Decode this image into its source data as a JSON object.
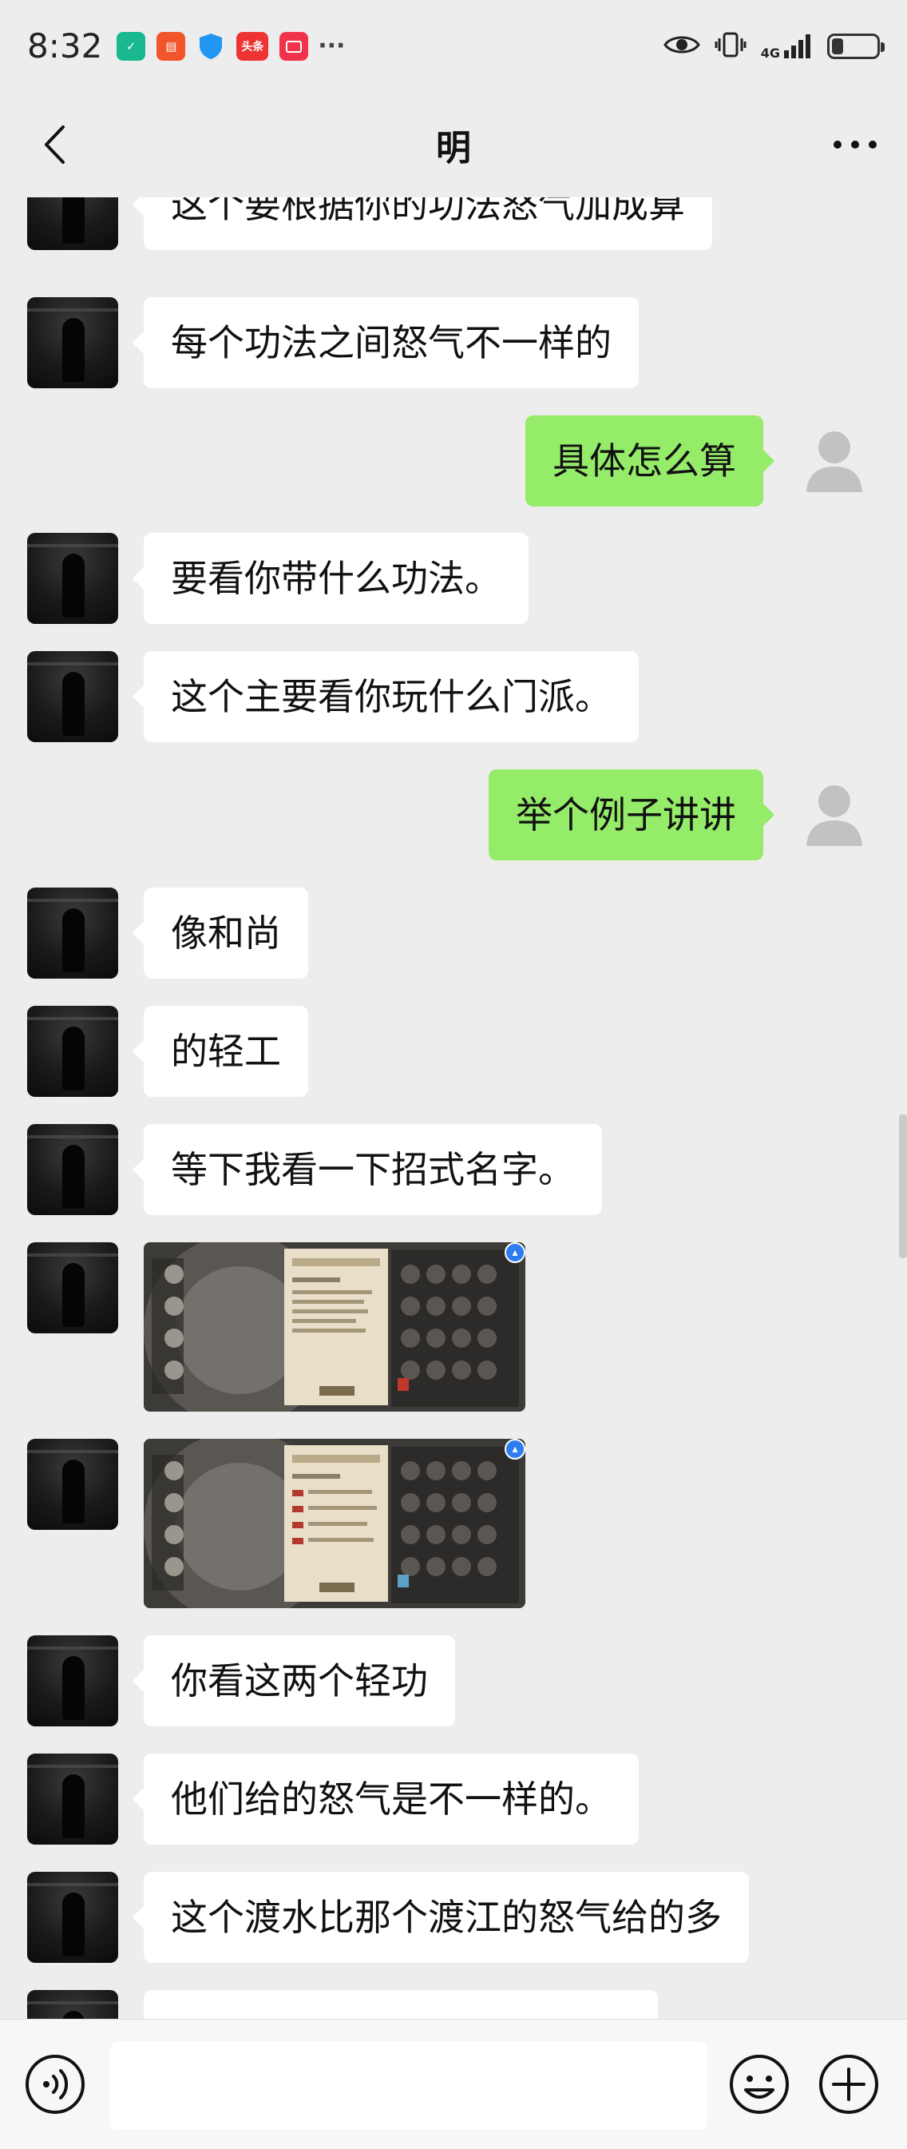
{
  "status_bar": {
    "time": "8:32",
    "notifications": [
      {
        "icon": "shield-app-icon",
        "label": ""
      },
      {
        "icon": "colorful-app-icon",
        "label": ""
      },
      {
        "icon": "blue-shield-icon",
        "label": ""
      },
      {
        "icon": "toutiao-icon",
        "label": "头条"
      },
      {
        "icon": "red-app-icon",
        "label": ""
      },
      {
        "icon": "more-notifications-icon",
        "label": "···"
      }
    ],
    "network": "4G",
    "battery_level": 0.25
  },
  "header": {
    "title": "明",
    "back_icon": "chevron-left-icon",
    "more_icon": "more-dots-icon"
  },
  "messages": [
    {
      "side": "left",
      "type": "text",
      "text": "这个要根据你的功法怒气加成算"
    },
    {
      "side": "left",
      "type": "text",
      "text": "每个功法之间怒气不一样的"
    },
    {
      "side": "right",
      "type": "text",
      "text": "具体怎么算"
    },
    {
      "side": "left",
      "type": "text",
      "text": "要看你带什么功法。"
    },
    {
      "side": "left",
      "type": "text",
      "text": "这个主要看你玩什么门派。"
    },
    {
      "side": "right",
      "type": "text",
      "text": "举个例子讲讲"
    },
    {
      "side": "left",
      "type": "text",
      "text": "像和尚"
    },
    {
      "side": "left",
      "type": "text",
      "text": "的轻工"
    },
    {
      "side": "left",
      "type": "text",
      "text": "等下我看一下招式名字。"
    },
    {
      "side": "left",
      "type": "image",
      "text": ""
    },
    {
      "side": "left",
      "type": "image",
      "text": ""
    },
    {
      "side": "left",
      "type": "text",
      "text": "你看这两个轻功"
    },
    {
      "side": "left",
      "type": "text",
      "text": "他们给的怒气是不一样的。"
    },
    {
      "side": "left",
      "type": "text",
      "text": "这个渡水比那个渡江的怒气给的多"
    }
  ],
  "input_bar": {
    "voice_icon": "voice-icon",
    "emoji_icon": "emoji-icon",
    "plus_icon": "plus-icon"
  },
  "colors": {
    "background": "#ededed",
    "my_bubble": "#95ec69",
    "their_bubble": "#ffffff",
    "image_badge": "#2d7cf0"
  }
}
